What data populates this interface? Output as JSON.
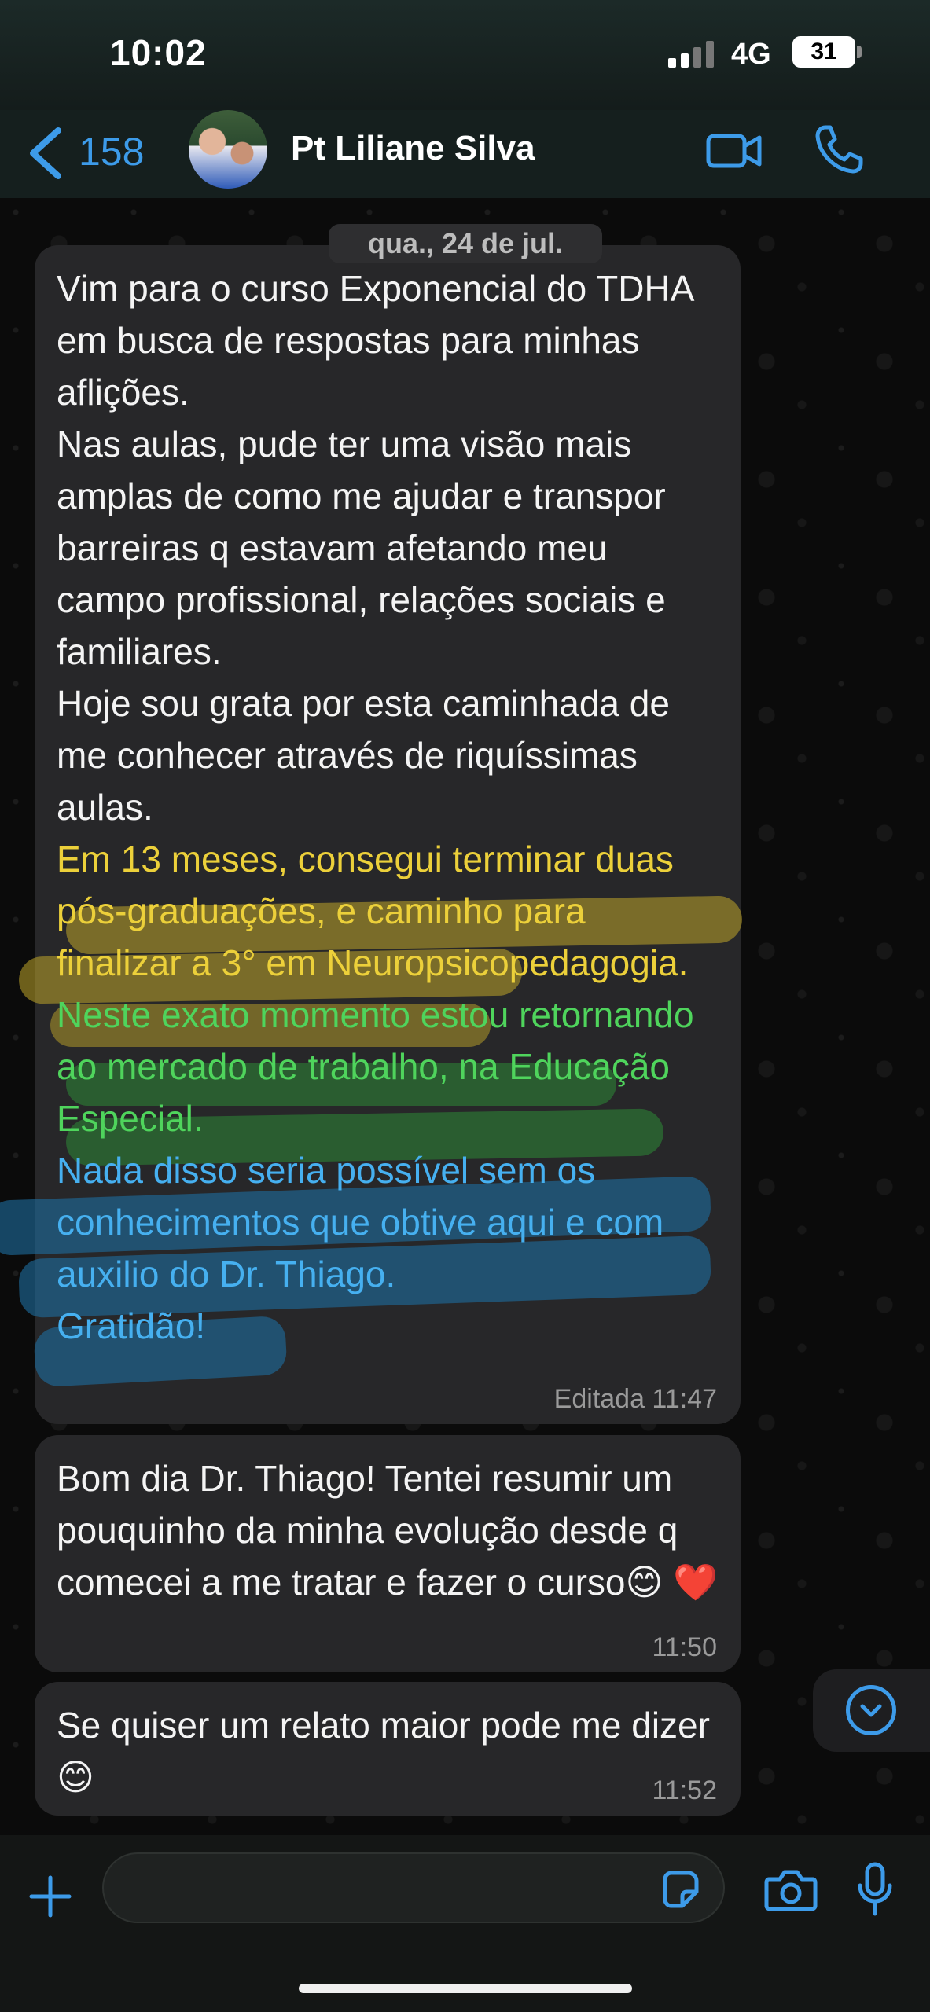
{
  "status_bar": {
    "time": "10:02",
    "network": "4G",
    "battery": "31"
  },
  "header": {
    "back_count": "158",
    "contact_name": "Pt Liliane Silva"
  },
  "date_separator": "qua., 24 de jul.",
  "messages": [
    {
      "lines_plain": [
        "Vim para o curso Exponencial do TDHA em busca de respostas para minhas aflições.",
        "Nas aulas, pude ter uma visão mais amplas de como me ajudar e transpor barreiras q estavam afetando meu campo profissional, relações sociais e familiares.",
        "Hoje sou grata por esta caminhada de me conhecer através de riquíssimas aulas."
      ],
      "highlight_yellow": "Em 13 meses, consegui terminar duas pós-graduações, e caminho para finalizar a 3° em Neuropsicopedagogia.",
      "highlight_green": "Neste exato momento estou retornando ao mercado de trabalho, na Educação Especial.",
      "highlight_blue": "Nada disso seria possível sem os conhecimentos que obtive aqui e com auxilio do Dr. Thiago.",
      "highlight_blue_end": "Gratidão!",
      "meta": "Editada 11:47"
    },
    {
      "text": "Bom dia Dr. Thiago! Tentei resumir um pouquinho da minha evolução desde q comecei a me tratar e fazer o curso😊 ❤️",
      "time": "11:50"
    },
    {
      "text": "Se quiser um relato maior pode me dizer😊",
      "time": "11:52"
    }
  ],
  "input": {
    "placeholder": ""
  },
  "icons": {
    "back": "chevron-left-icon",
    "video": "video-camera-icon",
    "phone": "phone-icon",
    "plus": "plus-icon",
    "sticker": "sticker-icon",
    "camera": "camera-icon",
    "mic": "microphone-icon",
    "scroll": "chevron-down-icon"
  },
  "colors": {
    "accent": "#3d9be9",
    "bubble": "#272729",
    "highlight_yellow": "#ecd03a",
    "highlight_green": "#4fd45c",
    "highlight_blue": "#46b0f0"
  }
}
